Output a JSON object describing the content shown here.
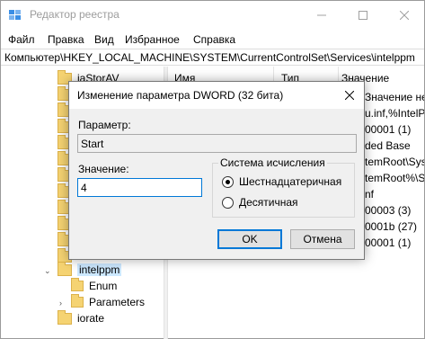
{
  "window": {
    "title": "Редактор реестра"
  },
  "menu": [
    "Файл",
    "Правка",
    "Вид",
    "Избранное",
    "Справка"
  ],
  "address": "Компьютер\\HKEY_LOCAL_MACHINE\\SYSTEM\\CurrentControlSet\\Services\\intelppm",
  "tree": {
    "items": [
      {
        "label": "iaStorAV"
      },
      {
        "label": "intelppm",
        "selected": true
      },
      {
        "label": "Enum"
      },
      {
        "label": "Parameters"
      },
      {
        "label": "iorate"
      }
    ]
  },
  "list": {
    "headers": {
      "name": "Имя",
      "type": "Тип",
      "value": "Значение"
    },
    "values": [
      "Значение не при",
      "u.inf,%IntelP",
      "00001 (1)",
      "ded Base",
      "temRoot\\Syst",
      "temRoot%\\S",
      "nf",
      "00003 (3)",
      "0001b (27)",
      "00001 (1)"
    ]
  },
  "dialog": {
    "title": "Изменение параметра DWORD (32 бита)",
    "param_label": "Параметр:",
    "param_value": "Start",
    "value_label": "Значение:",
    "value_input": "4",
    "base_group_title": "Система исчисления",
    "radio_hex": "Шестнадцатеричная",
    "radio_dec": "Десятичная",
    "ok_label": "OK",
    "cancel_label": "Отмена"
  },
  "colors": {
    "selection": "#cce8ff",
    "accent": "#0078d7",
    "folder": "#f5d372"
  }
}
